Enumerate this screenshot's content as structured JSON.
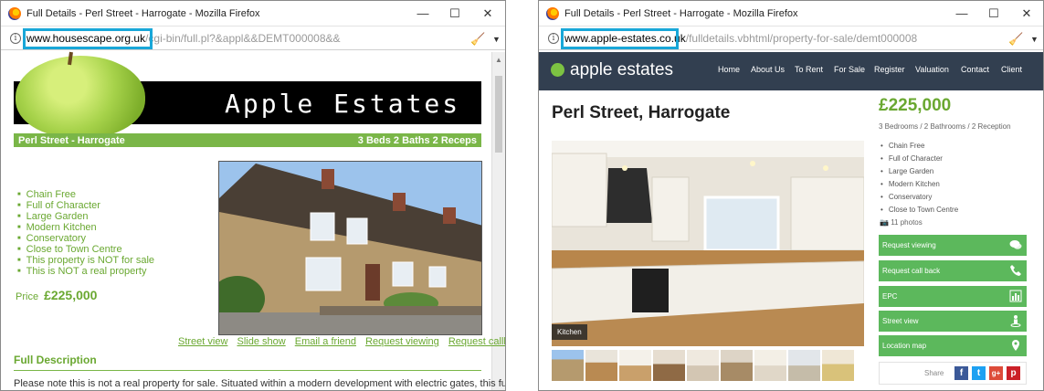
{
  "left_window": {
    "title": "Full Details - Perl Street - Harrogate - Mozilla Firefox",
    "url_domain": "www.housescape.org.uk",
    "url_rest": "/cgi-bin/full.pl?&appl&&DEMT000008&&",
    "banner_text": "Apple Estates",
    "heading_left": "Perl Street - Harrogate",
    "heading_right": "3 Beds 2 Baths 2 Receps",
    "features": [
      "Chain Free",
      "Full of Character",
      "Large Garden",
      "Modern Kitchen",
      "Conservatory",
      "Close to Town Centre",
      "This property is NOT for sale",
      "This is NOT a real property"
    ],
    "price_label": "Price",
    "price_value": "£225,000",
    "links": [
      "Street view",
      "Slide show",
      "Email a friend",
      "Request viewing",
      "Request callback"
    ],
    "full_description_heading": "Full Description",
    "description_text": "Please note this is not a real property for sale. Situated within a modern development with electric gates, this fully"
  },
  "right_window": {
    "title": "Full Details - Perl Street - Harrogate - Mozilla Firefox",
    "url_domain": "www.apple-estates.co.uk",
    "url_rest": "/fulldetails.vbhtml/property-for-sale/demt000008",
    "logo_text": "apple estates",
    "nav": [
      "Home",
      "About Us",
      "To Rent",
      "For Sale",
      "Register",
      "Valuation",
      "Contact",
      "Client"
    ],
    "property_title": "Perl Street, Harrogate",
    "price": "£225,000",
    "rooms": "3 Bedrooms / 2 Bathrooms / 2 Reception",
    "features": [
      "Chain Free",
      "Full of Character",
      "Large Garden",
      "Modern Kitchen",
      "Conservatory",
      "Close to Town Centre"
    ],
    "photo_count": "11 photos",
    "photo_caption": "Kitchen",
    "actions": [
      "Request viewing",
      "Request call back",
      "EPC",
      "Street view",
      "Location map"
    ],
    "share_label": "Share",
    "social": [
      "f",
      "t",
      "g+",
      "p"
    ]
  },
  "colors": {
    "highlight_box": "#19a7d8",
    "green": "#7ab648",
    "action_green": "#5cb85c",
    "navbar": "#323f50"
  }
}
